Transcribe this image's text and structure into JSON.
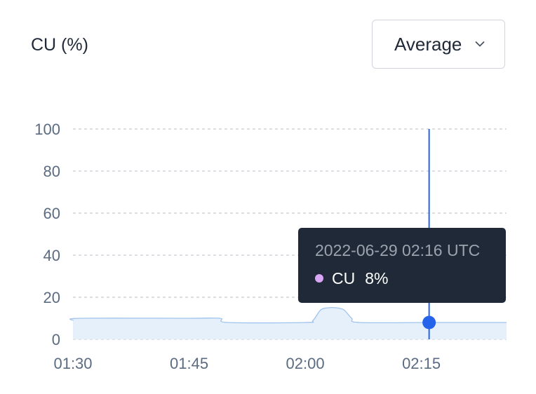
{
  "header": {
    "title": "CU (%)",
    "aggregation_select": {
      "selected": "Average"
    }
  },
  "tooltip": {
    "timestamp": "2022-06-29 02:16 UTC",
    "series": "CU",
    "value": "8%"
  },
  "colors": {
    "area_fill": "#e6f0fb",
    "area_line": "#9ec3ee",
    "cursor": "#2563eb",
    "grid": "#c7ccd4",
    "tooltip_dot": "#d8a6f5"
  },
  "chart_data": {
    "type": "area",
    "title": "CU (%)",
    "x_tick_labels": [
      "01:30",
      "01:45",
      "02:00",
      "02:15"
    ],
    "y_tick_labels": [
      "0",
      "20",
      "40",
      "60",
      "80",
      "100"
    ],
    "ylim": [
      0,
      100
    ],
    "xlim": [
      "01:30",
      "02:26"
    ],
    "grid": true,
    "series": [
      {
        "name": "CU",
        "x": [
          "01:30",
          "01:31",
          "01:45",
          "01:49",
          "01:50",
          "02:00",
          "02:01",
          "02:02",
          "02:03",
          "02:04",
          "02:05",
          "02:06",
          "02:07",
          "02:16",
          "02:26"
        ],
        "values": [
          9,
          10,
          10,
          10,
          8,
          8,
          9,
          14,
          15,
          15,
          14,
          10,
          8,
          8,
          8
        ]
      }
    ],
    "highlight": {
      "x": "02:16",
      "value": 8
    }
  }
}
